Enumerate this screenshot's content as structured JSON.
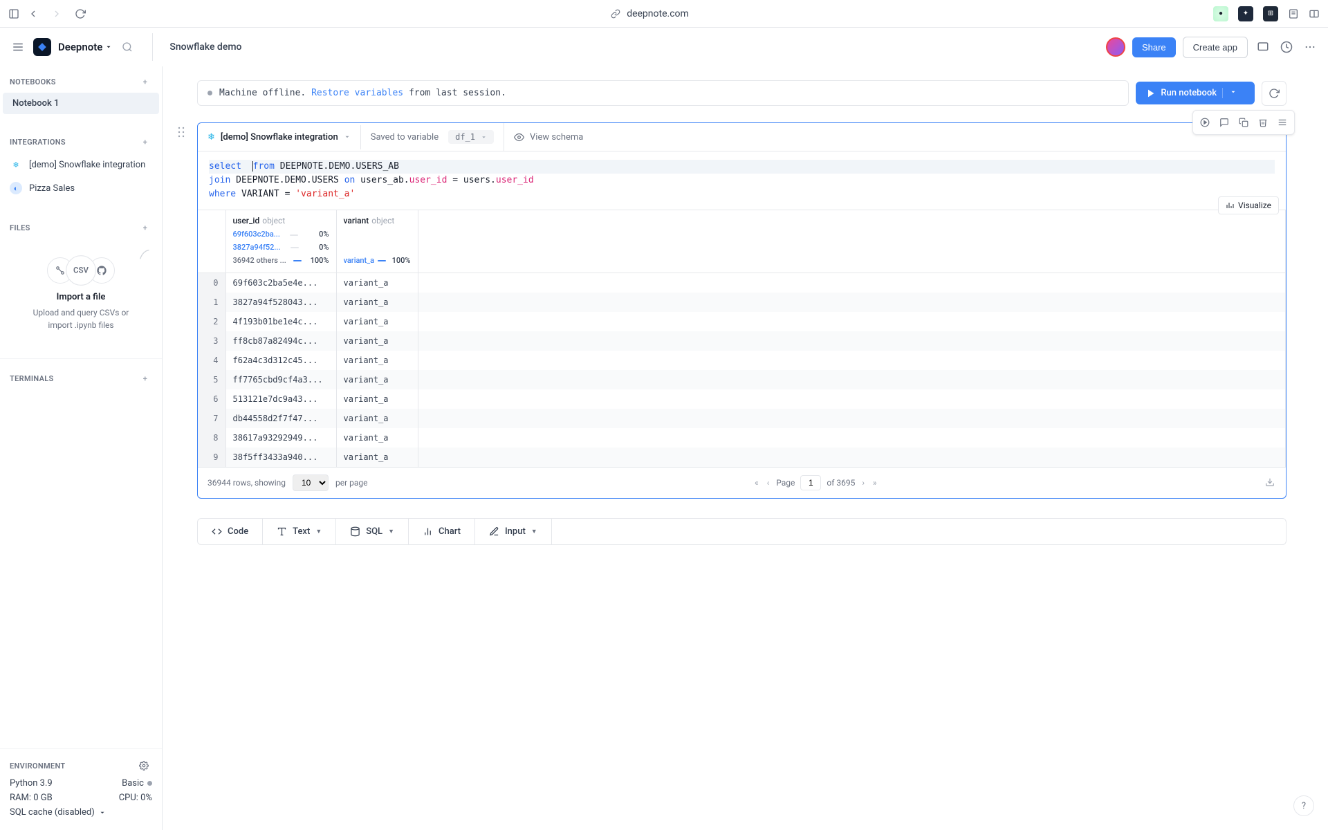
{
  "browser": {
    "url": "deepnote.com"
  },
  "header": {
    "brand": "Deepnote",
    "title": "Snowflake demo",
    "share": "Share",
    "createApp": "Create app"
  },
  "sidebar": {
    "notebooks": {
      "label": "NOTEBOOKS",
      "items": [
        "Notebook 1"
      ]
    },
    "integrations": {
      "label": "INTEGRATIONS",
      "items": [
        "[demo] Snowflake integration",
        "Pizza Sales"
      ]
    },
    "files": {
      "label": "FILES",
      "dropTitle": "Import a file",
      "dropSub": "Upload and query CSVs or import .ipynb files"
    },
    "terminals": {
      "label": "TERMINALS"
    },
    "env": {
      "label": "ENVIRONMENT",
      "python": "Python 3.9",
      "plan": "Basic",
      "ram": "RAM: 0 GB",
      "cpu": "CPU: 0%",
      "cache": "SQL cache (disabled)"
    }
  },
  "status": {
    "prefix": "Machine offline. ",
    "link": "Restore variables",
    "suffix": " from last session.",
    "run": "Run notebook"
  },
  "cell": {
    "integration": "[demo] Snowflake integration",
    "savedTo": "Saved to variable",
    "varName": "df_1",
    "viewSchema": "View schema",
    "visualize": "Visualize",
    "columns": [
      {
        "name": "user_id",
        "type": "object",
        "stats": [
          {
            "val": "69f603c2ba...",
            "pct": "0%",
            "kind": "val"
          },
          {
            "val": "3827a94f52...",
            "pct": "0%",
            "kind": "val"
          },
          {
            "val": "36942 others ...",
            "pct": "100%",
            "kind": "other"
          }
        ]
      },
      {
        "name": "variant",
        "type": "object",
        "stats": [
          {
            "val": "",
            "pct": "",
            "kind": "blank"
          },
          {
            "val": "",
            "pct": "",
            "kind": "blank"
          },
          {
            "val": "variant_a",
            "pct": "100%",
            "kind": "val"
          }
        ]
      }
    ],
    "rows": [
      {
        "i": "0",
        "user_id": "69f603c2ba5e4e...",
        "variant": "variant_a"
      },
      {
        "i": "1",
        "user_id": "3827a94f528043...",
        "variant": "variant_a"
      },
      {
        "i": "2",
        "user_id": "4f193b01be1e4c...",
        "variant": "variant_a"
      },
      {
        "i": "3",
        "user_id": "ff8cb87a82494c...",
        "variant": "variant_a"
      },
      {
        "i": "4",
        "user_id": "f62a4c3d312c45...",
        "variant": "variant_a"
      },
      {
        "i": "5",
        "user_id": "ff7765cbd9cf4a3...",
        "variant": "variant_a"
      },
      {
        "i": "6",
        "user_id": "513121e7dc9a43...",
        "variant": "variant_a"
      },
      {
        "i": "7",
        "user_id": "db44558d2f7f47...",
        "variant": "variant_a"
      },
      {
        "i": "8",
        "user_id": "38617a93292949...",
        "variant": "variant_a"
      },
      {
        "i": "9",
        "user_id": "38f5ff3433a940...",
        "variant": "variant_a"
      }
    ],
    "pager": {
      "summary": "36944 rows, showing",
      "pageSize": "10",
      "perPage": "per page",
      "pageLabel": "Page",
      "pageNum": "1",
      "ofTotal": "of 3695"
    }
  },
  "toolbar": {
    "code": "Code",
    "text": "Text",
    "sql": "SQL",
    "chart": "Chart",
    "input": "Input"
  }
}
